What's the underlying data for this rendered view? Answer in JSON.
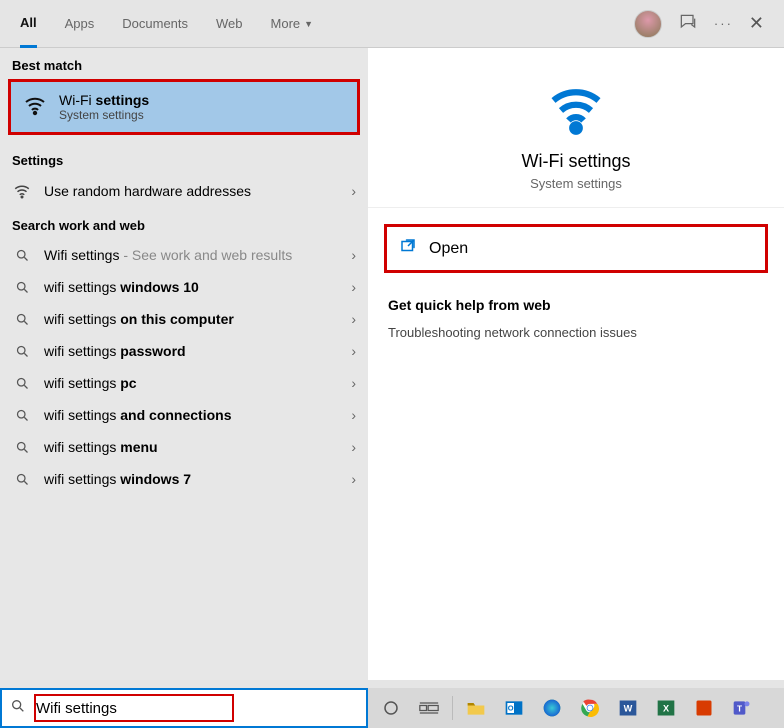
{
  "tabs": {
    "all": "All",
    "apps": "Apps",
    "documents": "Documents",
    "web": "Web",
    "more": "More"
  },
  "sections": {
    "best_match": "Best match",
    "settings": "Settings",
    "search_web": "Search work and web"
  },
  "best_match": {
    "title_pre": "Wi-Fi ",
    "title_bold": "settings",
    "subtitle": "System settings"
  },
  "settings_rows": [
    {
      "label": "Use random hardware addresses",
      "icon": "wifi"
    }
  ],
  "web_rows": [
    {
      "pre": "Wifi settings",
      "bold": "",
      "suffix": " - See work and web results"
    },
    {
      "pre": "wifi settings ",
      "bold": "windows 10",
      "suffix": ""
    },
    {
      "pre": "wifi settings ",
      "bold": "on this computer",
      "suffix": ""
    },
    {
      "pre": "wifi settings ",
      "bold": "password",
      "suffix": ""
    },
    {
      "pre": "wifi settings ",
      "bold": "pc",
      "suffix": ""
    },
    {
      "pre": "wifi settings ",
      "bold": "and connections",
      "suffix": ""
    },
    {
      "pre": "wifi settings ",
      "bold": "menu",
      "suffix": ""
    },
    {
      "pre": "wifi settings ",
      "bold": "windows 7",
      "suffix": ""
    }
  ],
  "preview": {
    "title": "Wi-Fi settings",
    "subtitle": "System settings",
    "open": "Open"
  },
  "help": {
    "title": "Get quick help from web",
    "link": "Troubleshooting network connection issues"
  },
  "search": {
    "value": "Wifi settings"
  }
}
